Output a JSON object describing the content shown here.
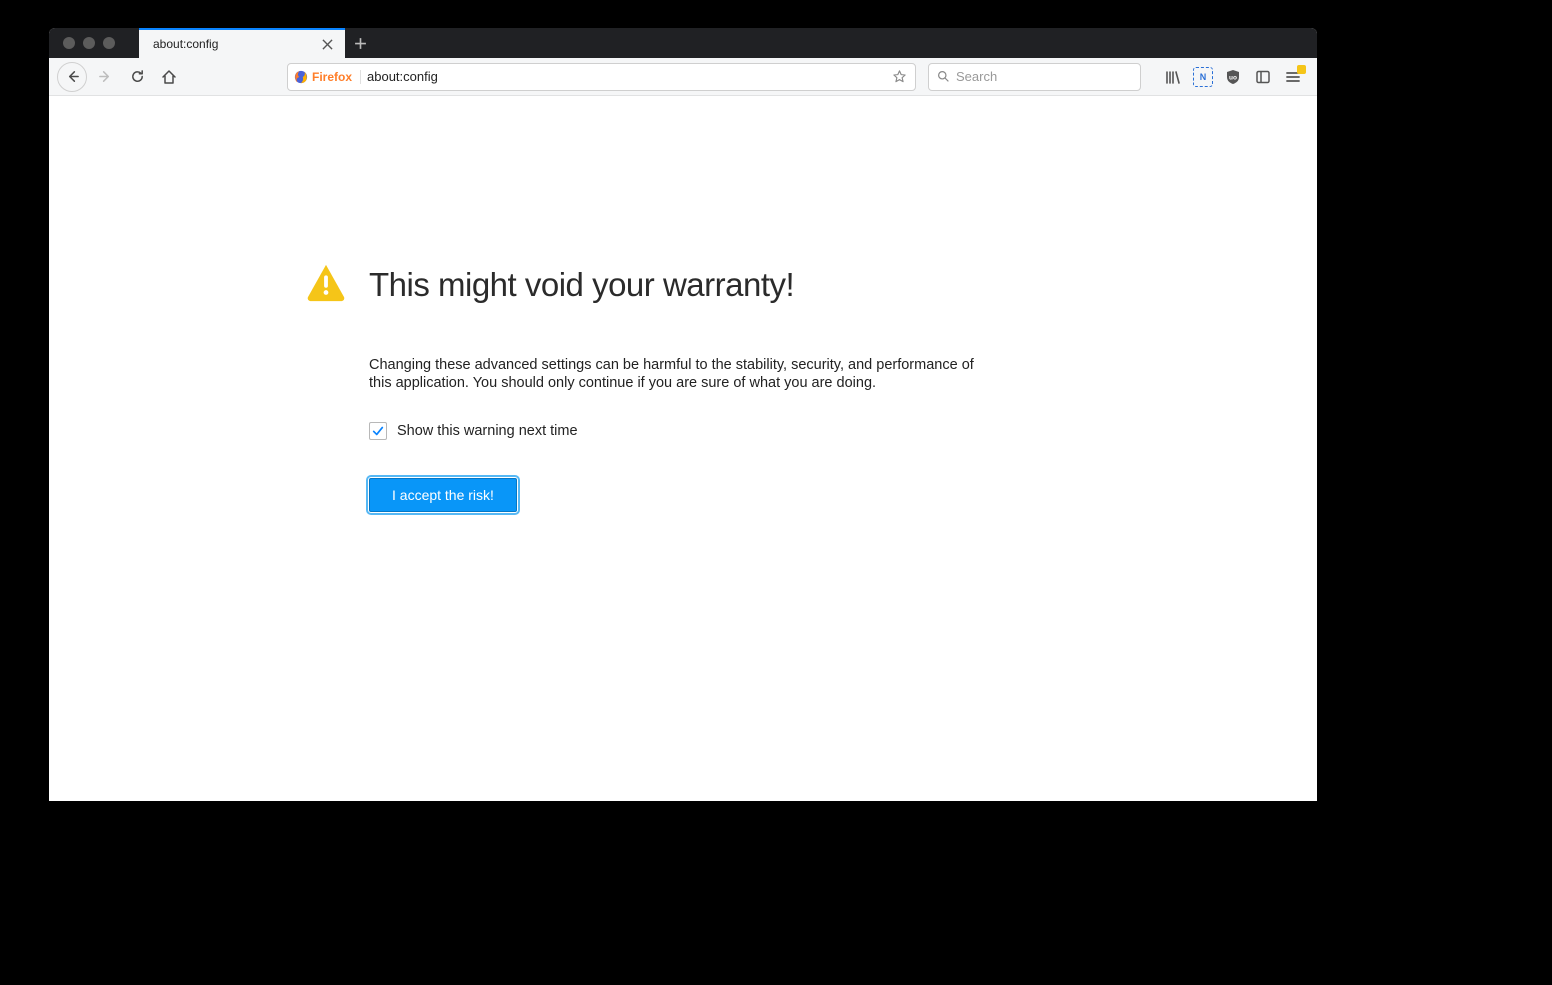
{
  "tab": {
    "label": "about:config"
  },
  "urlbar": {
    "badge": "Firefox",
    "value": "about:config"
  },
  "searchbar": {
    "placeholder": "Search"
  },
  "warning": {
    "title": "This might void your warranty!",
    "body": "Changing these advanced settings can be harmful to the stability, security, and performance of this application. You should only continue if you are sure of what you are doing.",
    "checkbox_label": "Show this warning next time",
    "checkbox_checked": true,
    "accept_button": "I accept the risk!"
  },
  "colors": {
    "accent": "#0a84ff",
    "warning_triangle": "#f5c518",
    "firefox_orange": "#ff7e29"
  }
}
